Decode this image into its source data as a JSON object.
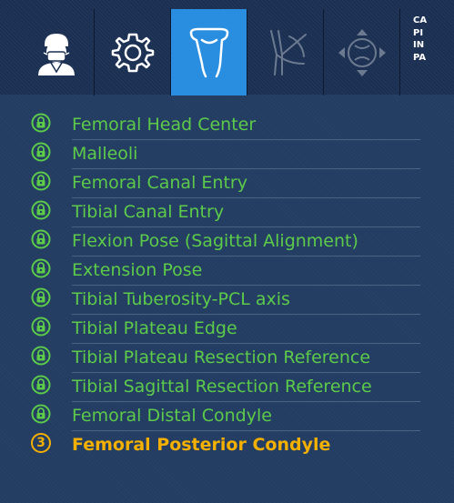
{
  "toolbar": {
    "tabs": [
      {
        "icon": "surgeon-icon",
        "state": "normal"
      },
      {
        "icon": "gear-icon",
        "state": "normal"
      },
      {
        "icon": "femur-bone-icon",
        "state": "active"
      },
      {
        "icon": "leg-alignment-icon",
        "state": "disabled"
      },
      {
        "icon": "knee-balance-icon",
        "state": "disabled"
      }
    ],
    "info_lines": [
      "CA",
      "PI",
      "IN",
      "PA"
    ]
  },
  "steps": [
    {
      "label": "Femoral Head Center",
      "status": "locked"
    },
    {
      "label": "Malleoli",
      "status": "locked"
    },
    {
      "label": "Femoral Canal Entry",
      "status": "locked"
    },
    {
      "label": "Tibial Canal Entry",
      "status": "locked"
    },
    {
      "label": "Flexion Pose (Sagittal Alignment)",
      "status": "locked"
    },
    {
      "label": "Extension Pose",
      "status": "locked"
    },
    {
      "label": "Tibial Tuberosity-PCL axis",
      "status": "locked"
    },
    {
      "label": "Tibial Plateau Edge",
      "status": "locked"
    },
    {
      "label": "Tibial Plateau Resection Reference",
      "status": "locked"
    },
    {
      "label": "Tibial Sagittal Resection Reference",
      "status": "locked"
    },
    {
      "label": "Femoral Distal Condyle",
      "status": "locked"
    },
    {
      "label": "Femoral Posterior Condyle",
      "status": "current",
      "badge": "3"
    }
  ],
  "colors": {
    "completed": "#5ccb4a",
    "current": "#f4b000",
    "active_tab": "#2a8ee0",
    "panel_bg": "#233c62"
  }
}
